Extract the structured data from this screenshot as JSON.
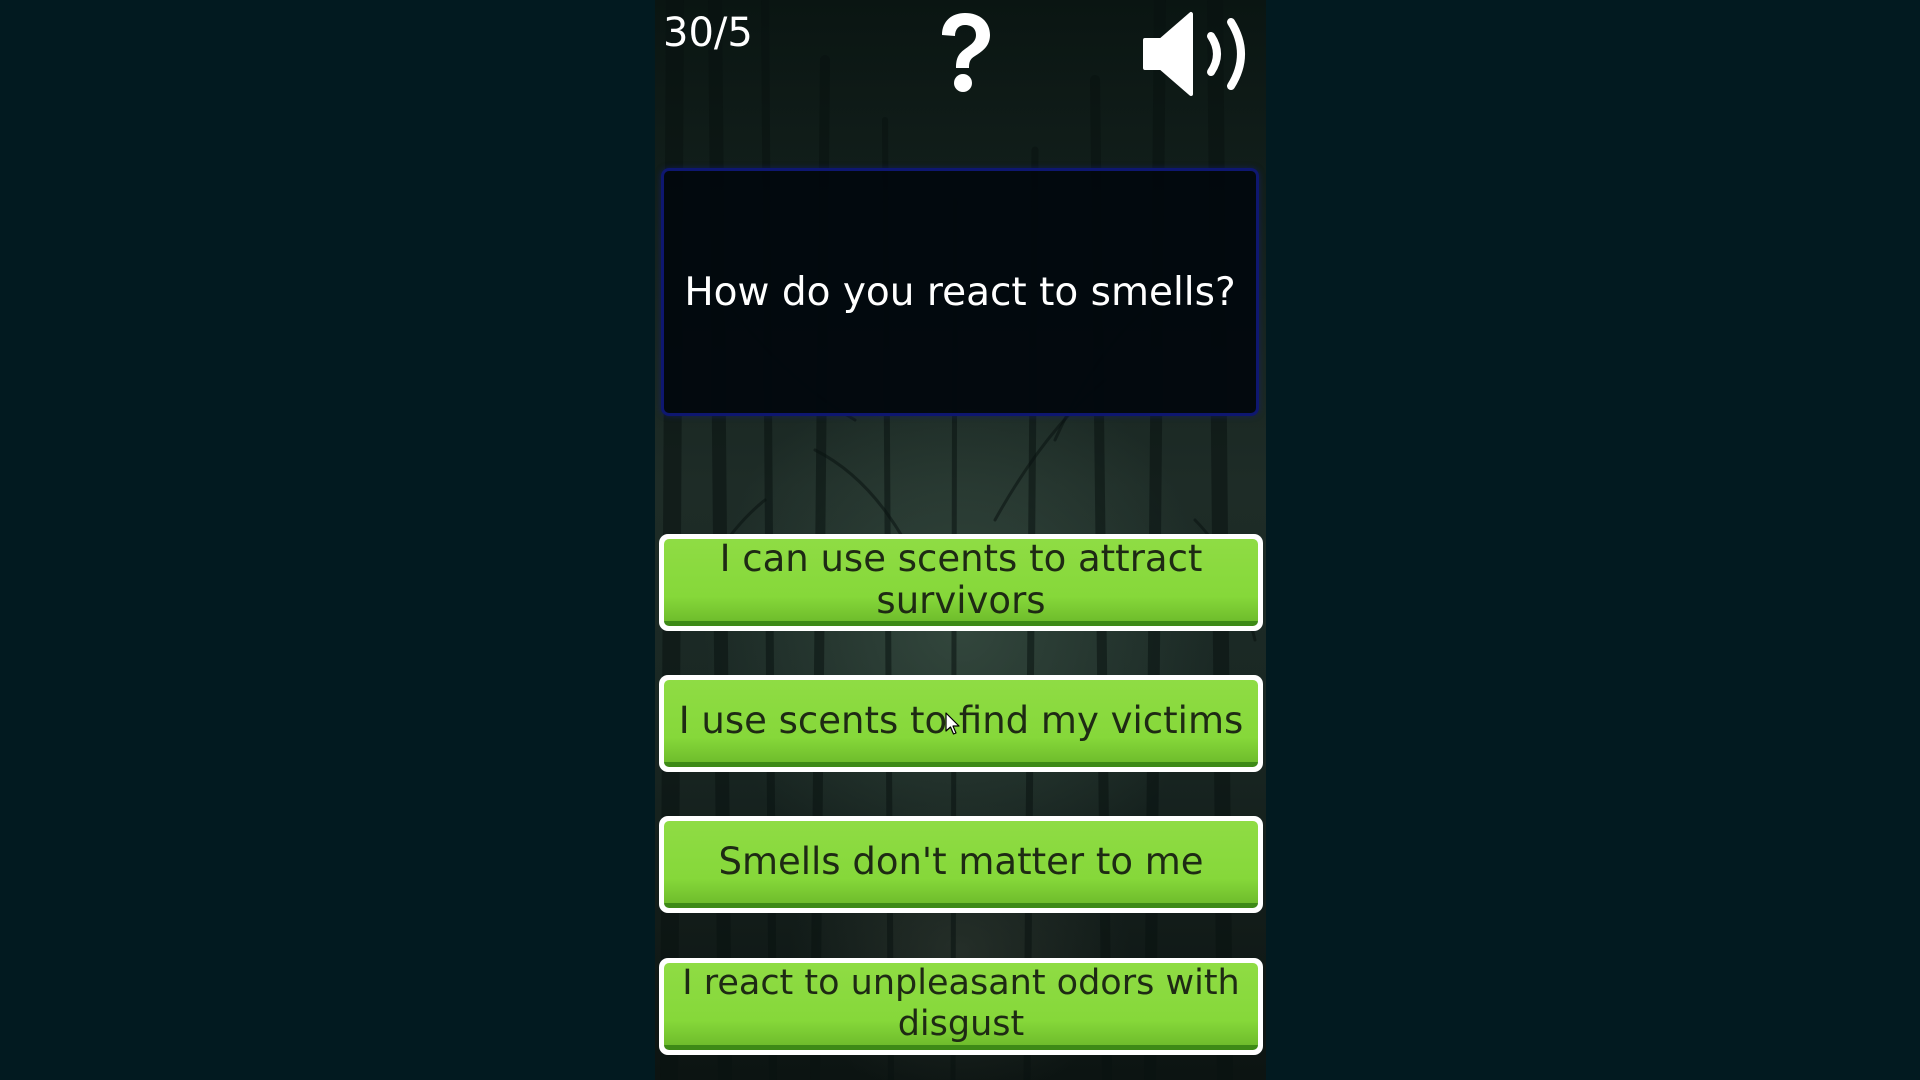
{
  "hud": {
    "progress_text": "30/5",
    "help_icon": "question-mark-icon",
    "sound_icon": "speaker-volume-icon"
  },
  "question": {
    "text": "How do you react to smells?"
  },
  "answers": [
    {
      "label": "I can use scents to attract survivors"
    },
    {
      "label": "I use scents to find my victims"
    },
    {
      "label": "Smells don't matter to me"
    },
    {
      "label": "I react to unpleasant odors with disgust"
    }
  ],
  "colors": {
    "background": "#021a20",
    "answer_fill": "#86d83a",
    "answer_border": "#ffffff",
    "question_box_border": "#0e1770",
    "text_light": "#ffffff",
    "text_dark": "#1e2a14"
  }
}
